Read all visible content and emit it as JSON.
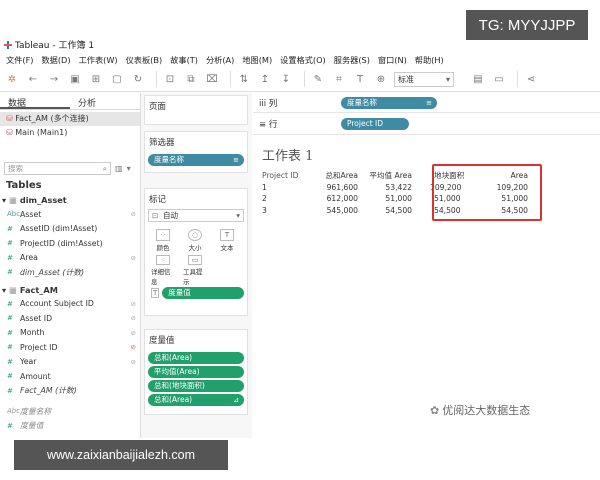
{
  "window": {
    "title": "Tableau - 工作簿 1"
  },
  "watermarks": {
    "top_right": "TG: MYYJJPP",
    "bottom_left": "www.zaixianbaijialezh.com",
    "bottom_right": "优阅达大数据生态"
  },
  "menu": [
    "文件(F)",
    "数据(D)",
    "工作表(W)",
    "仪表板(B)",
    "故事(T)",
    "分析(A)",
    "地图(M)",
    "设置格式(O)",
    "服务器(S)",
    "窗口(N)",
    "帮助(H)"
  ],
  "toolbar": {
    "fit_select": "标准"
  },
  "left": {
    "tabs": [
      "数据",
      "分析"
    ],
    "connections": [
      "Fact_AM (多个连接)",
      "Main (Main1)"
    ],
    "search_placeholder": "搜索",
    "tables_heading": "Tables",
    "groups": [
      {
        "name": "dim_Asset",
        "fields": [
          {
            "icon": "Abc",
            "name": "Asset"
          },
          {
            "icon": "#",
            "name": "AssetID (dim!Asset)"
          },
          {
            "icon": "#",
            "name": "ProjectID (dim!Asset)"
          },
          {
            "icon": "#",
            "name": "Area"
          },
          {
            "icon": "#",
            "name": "dim_Asset (计数)"
          }
        ]
      },
      {
        "name": "Fact_AM",
        "fields": [
          {
            "icon": "#",
            "name": "Account Subject ID"
          },
          {
            "icon": "#",
            "name": "Asset ID"
          },
          {
            "icon": "#",
            "name": "Month"
          },
          {
            "icon": "#",
            "name": "Project ID"
          },
          {
            "icon": "#",
            "name": "Year"
          },
          {
            "icon": "#",
            "name": "Amount"
          },
          {
            "icon": "#",
            "name": "Fact_AM (计数)"
          }
        ]
      }
    ],
    "extra_fields": [
      {
        "icon": "Abc",
        "name": "度量名称"
      },
      {
        "icon": "#",
        "name": "度量值"
      }
    ]
  },
  "shelves": {
    "pages_label": "页面",
    "filters_label": "筛选器",
    "filters": [
      "度量名称"
    ],
    "marks_label": "标记",
    "marks_type": "自动",
    "marks_buttons": [
      "颜色",
      "大小",
      "文本",
      "详细信息",
      "工具提示"
    ],
    "marks_pill": "度量值",
    "measure_values_label": "度量值",
    "measure_values": [
      "总和(Area)",
      "平均值(Area)",
      "总和(地块面积)",
      "总和(Area)"
    ]
  },
  "columns": {
    "label": "列",
    "pill": "度量名称"
  },
  "rows": {
    "label": "行",
    "pill": "Project ID"
  },
  "sheet": {
    "title": "工作表 1",
    "headers": [
      "Project ID",
      "总和Area",
      "平均值 Area",
      "地块面积",
      "Area"
    ],
    "rows": [
      [
        "1",
        "961,600",
        "53,422",
        "109,200",
        "109,200"
      ],
      [
        "2",
        "612,000",
        "51,000",
        "51,000",
        "51,000"
      ],
      [
        "3",
        "545,000",
        "54,500",
        "54,500",
        "54,500"
      ]
    ]
  }
}
